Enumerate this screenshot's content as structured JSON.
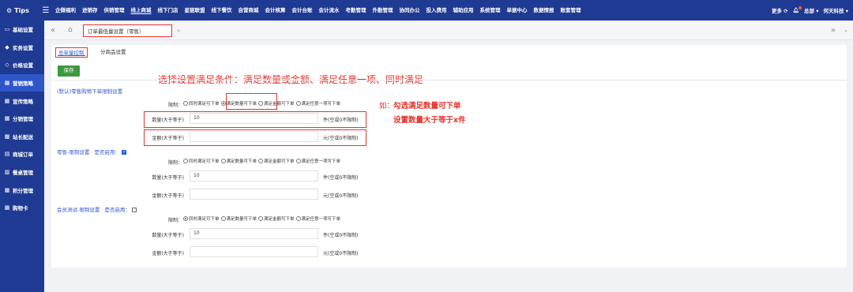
{
  "brand": "Tips",
  "nav": [
    "企微福利",
    "进销存",
    "供销管理",
    "线上商城",
    "线下门店",
    "星链联盟",
    "线下餐饮",
    "自营商城",
    "会计核算",
    "会计台账",
    "会计流水",
    "考勤管理",
    "外勤管理",
    "协同办公",
    "投入费用",
    "辅助应用",
    "系统管理",
    "单据中心",
    "数据情报",
    "账套管理"
  ],
  "nav_active_index": 3,
  "topright": {
    "more": "更多",
    "user": "总部",
    "company": "何天科技"
  },
  "sidebar": [
    "基础设置",
    "实务设置",
    "价格设置",
    "营销策略",
    "宣传策略",
    "分销管理",
    "站长配送",
    "商城订单",
    "餐桌管理",
    "积分管理",
    "购物卡"
  ],
  "sidebar_icons": [
    "window-icon",
    "diamond-icon",
    "tag-icon",
    "chart-icon",
    "chart-icon",
    "chart-icon",
    "chart-icon",
    "order-icon",
    "table-icon",
    "chart-icon",
    "chart-icon"
  ],
  "page_tab": "订单最低量设置（零售）",
  "subtabs": {
    "active": "总单量控制",
    "other": "分商品设置"
  },
  "save": "保存",
  "annotation_top": "选择设置满足条件：满足数量或金额、满足任意一项、同时满足",
  "annotation_right_prefix": "如：",
  "annotation_right_1": "勾选满足数量可下单",
  "annotation_right_2": "设置数量大于等于x件",
  "labels": {
    "limit": "限制：",
    "qty": "数量(大于等于)",
    "amt": "金额(大于等于)",
    "qty_unit": "件(空或0不限制)",
    "amt_unit": "元(空或0不限制)"
  },
  "radio_options": [
    "同时满足可下单",
    "满足数量可下单",
    "满足金额可下单",
    "满足任意一项可下单"
  ],
  "sections": [
    {
      "title": "(默认)零售购物下单限制设置",
      "enable_label": "",
      "enabled": null,
      "selected": 1,
      "qty": "10",
      "amt": ""
    },
    {
      "title": "零售-限制设置",
      "enable_label": "是否启用：",
      "enabled": true,
      "selected": null,
      "qty": "10",
      "amt": ""
    },
    {
      "title": "会员测试-限制设置",
      "enable_label": "是否启用：",
      "enabled": false,
      "selected": 0,
      "qty": "10",
      "amt": ""
    }
  ],
  "colors": {
    "nav": "#1f3a93",
    "sidebar_active": "#2e56c9",
    "annotation": "#e8332a",
    "link": "#3355cc",
    "save": "#3c9a3c"
  }
}
